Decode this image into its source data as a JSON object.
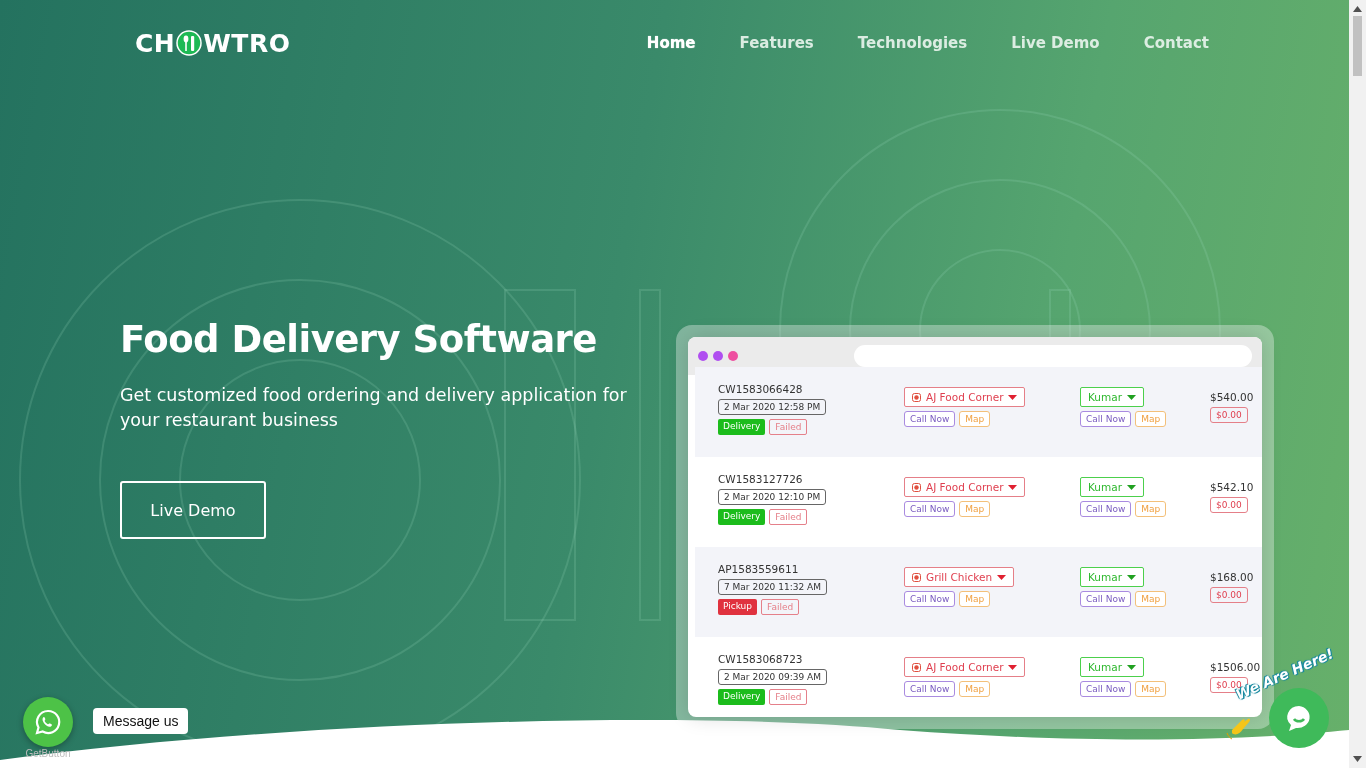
{
  "logo": {
    "before": "CH",
    "after": "WTRO"
  },
  "nav": [
    {
      "label": "Home",
      "selected": true
    },
    {
      "label": "Features",
      "selected": false
    },
    {
      "label": "Technologies",
      "selected": false
    },
    {
      "label": "Live Demo",
      "selected": false
    },
    {
      "label": "Contact",
      "selected": false
    }
  ],
  "hero": {
    "title": "Food Delivery Software",
    "subtitle": "Get customized food ordering and delivery application for your restaurant business",
    "button": "Live Demo"
  },
  "orders": [
    {
      "id": "CW1583066428",
      "date": "2 Mar 2020 12:58 PM",
      "type": {
        "kind": "delivery",
        "label": "Delivery"
      },
      "status": "Failed",
      "restaurant": "AJ Food Corner",
      "driver": "Kumar",
      "call": "Call Now",
      "map": "Map",
      "driver_call": "Call Now",
      "driver_map": "Map",
      "total": "$540.00",
      "due": "$0.00"
    },
    {
      "id": "CW1583127726",
      "date": "2 Mar 2020 12:10 PM",
      "type": {
        "kind": "delivery",
        "label": "Delivery"
      },
      "status": "Failed",
      "restaurant": "AJ Food Corner",
      "driver": "Kumar",
      "call": "Call Now",
      "map": "Map",
      "driver_call": "Call Now",
      "driver_map": "Map",
      "total": "$542.10",
      "due": "$0.00"
    },
    {
      "id": "AP1583559611",
      "date": "7 Mar 2020 11:32 AM",
      "type": {
        "kind": "pickup",
        "label": "Pickup"
      },
      "status": "Failed",
      "restaurant": "Grill Chicken",
      "driver": "Kumar",
      "call": "Call Now",
      "map": "Map",
      "driver_call": "Call Now",
      "driver_map": "Map",
      "total": "$168.00",
      "due": "$0.00"
    },
    {
      "id": "CW1583068723",
      "date": "2 Mar 2020 09:39 AM",
      "type": {
        "kind": "delivery",
        "label": "Delivery"
      },
      "status": "Failed",
      "restaurant": "AJ Food Corner",
      "driver": "Kumar",
      "call": "Call Now",
      "map": "Map",
      "driver_call": "Call Now",
      "driver_map": "Map",
      "total": "$1506.00",
      "due": "$0.00"
    }
  ],
  "whatsapp": {
    "tooltip": "Message us",
    "caption": "GetButton"
  },
  "chat": {
    "banner": "We Are Here!"
  }
}
